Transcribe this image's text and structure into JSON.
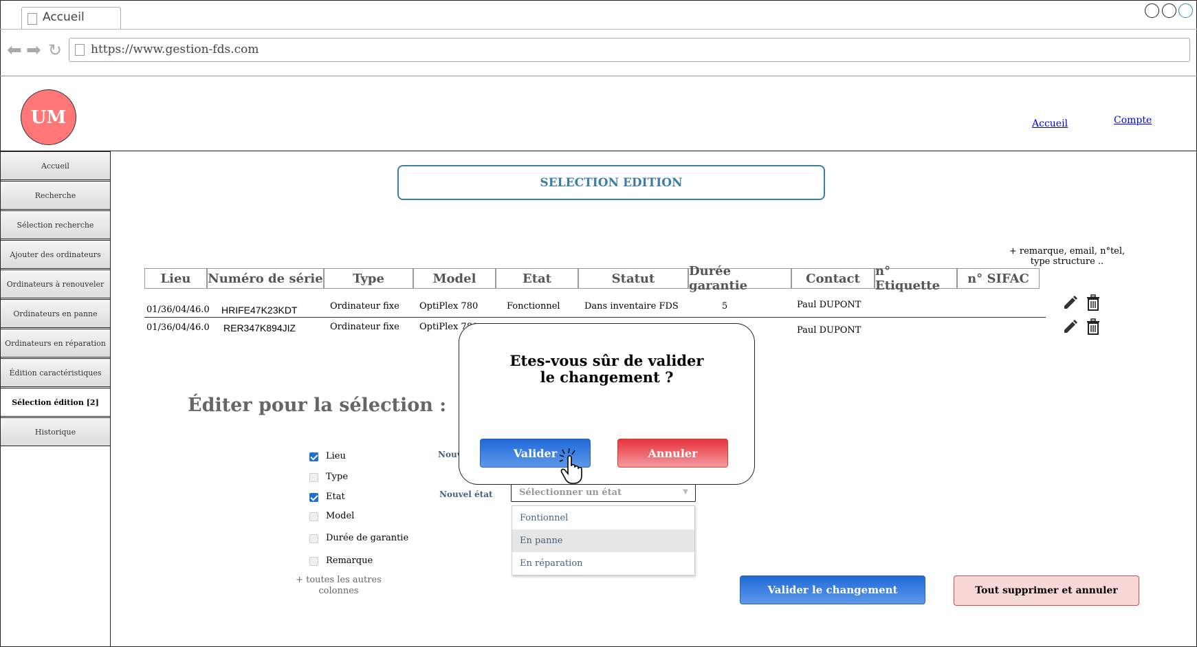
{
  "browser": {
    "tab_title": "Accueil",
    "url": "https://www.gestion-fds.com"
  },
  "header": {
    "logo_text": "UM",
    "links": {
      "home": "Accueil",
      "account": "Compte"
    }
  },
  "sidebar": {
    "items": [
      {
        "label": "Accueil"
      },
      {
        "label": "Recherche"
      },
      {
        "label": "Sélection recherche"
      },
      {
        "label": "Ajouter des ordinateurs"
      },
      {
        "label": "Ordinateurs à renouveler"
      },
      {
        "label": "Ordinateurs en panne"
      },
      {
        "label": "Ordinateurs en réparation"
      },
      {
        "label": "Édition caractéristiques"
      },
      {
        "label": "Sélection édition [2]",
        "active": true
      },
      {
        "label": "Historique"
      }
    ]
  },
  "main": {
    "title": "SELECTION EDITION",
    "note": "+ remarque, email, n°tel, type structure ..",
    "table": {
      "columns": [
        "Lieu",
        "Numéro de série",
        "Type",
        "Model",
        "Etat",
        "Statut",
        "Durée garantie",
        "Contact",
        "n° Etiquette",
        "n° SIFAC"
      ],
      "rows": [
        {
          "lieu": "01/36/04/46.0",
          "serie": "HRIFE47K23KDT",
          "type": "Ordinateur fixe",
          "model": "OptiPlex 780",
          "etat": "Fonctionnel",
          "statut": "Dans inventaire FDS",
          "garantie": "5",
          "contact": "Paul DUPONT",
          "etiquette": "",
          "sifac": ""
        },
        {
          "lieu": "01/36/04/46.0",
          "serie": "RER347K894JIZ",
          "type": "Ordinateur fixe",
          "model": "OptiPlex 780",
          "etat": "",
          "statut": "",
          "garantie": "",
          "contact": "Paul DUPONT",
          "etiquette": "",
          "sifac": ""
        }
      ]
    },
    "edit": {
      "title": "Éditer pour la sélection :",
      "checkboxes": [
        {
          "label": "Lieu",
          "checked": true
        },
        {
          "label": "Type",
          "checked": false
        },
        {
          "label": "Etat",
          "checked": true
        },
        {
          "label": "Model",
          "checked": false
        },
        {
          "label": "Durée de garantie",
          "checked": false
        },
        {
          "label": "Remarque",
          "checked": false
        }
      ],
      "more_columns": "+ toutes les autres colonnes",
      "field_lieu_label_partial": "Nouv",
      "field_etat_label": "Nouvel état",
      "select_placeholder": "Sélectionner un état",
      "dropdown_options": [
        "Fontionnel",
        "En panne",
        "En réparation"
      ],
      "dropdown_hovered": "En panne",
      "validate_button": "Valider le changement",
      "cancel_all_button": "Tout supprimer et annuler"
    }
  },
  "modal": {
    "message_line1": "Etes-vous sûr de valider",
    "message_line2": "le changement ?",
    "confirm": "Valider",
    "cancel": "Annuler"
  },
  "colors": {
    "accent_blue": "#3c7ea6",
    "button_blue": "#1f6ad8",
    "button_red": "#e8333c",
    "logo": "#ff7777"
  }
}
